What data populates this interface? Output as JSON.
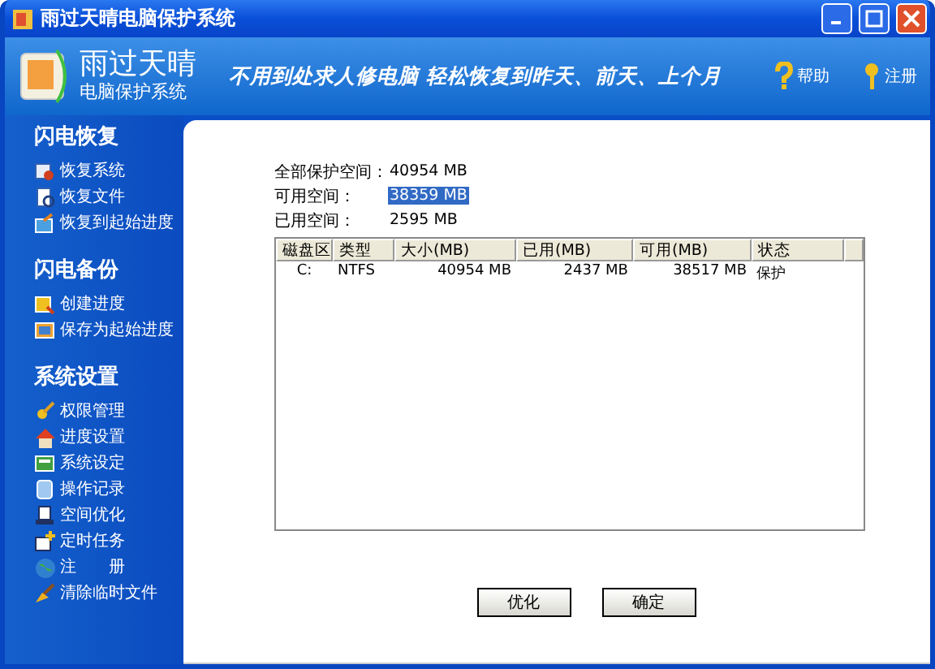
{
  "window": {
    "title": "雨过天晴电脑保护系统"
  },
  "header": {
    "logo_title": "雨过天晴",
    "logo_subtitle": "电脑保护系统",
    "slogan": "不用到处求人修电脑 轻松恢复到昨天、前天、上个月",
    "links": [
      "帮助",
      "注册"
    ]
  },
  "sidebar": [
    {
      "title": "闪电恢复",
      "items": [
        "恢复系统",
        "恢复文件",
        "恢复到起始进度"
      ]
    },
    {
      "title": "闪电备份",
      "items": [
        "创建进度",
        "保存为起始进度"
      ]
    },
    {
      "title": "系统设置",
      "items": [
        "权限管理",
        "进度设置",
        "系统设定",
        "操作记录",
        "空间优化",
        "定时任务",
        "注　　册",
        "清除临时文件"
      ]
    }
  ],
  "summary": [
    {
      "label": "全部保护空间：",
      "value": "40954 MB",
      "selected": false
    },
    {
      "label": "可用空间：",
      "value": "38359 MB",
      "selected": true
    },
    {
      "label": "已用空间：",
      "value": "2595 MB",
      "selected": false
    }
  ],
  "table": {
    "columns": [
      "磁盘区",
      "类型",
      "大小(MB)",
      "已用(MB)",
      "可用(MB)",
      "状态"
    ],
    "rows": [
      [
        "C:",
        "NTFS",
        "40954 MB",
        "2437 MB",
        "38517 MB",
        "保护"
      ]
    ]
  },
  "buttons": [
    "优化",
    "确定"
  ]
}
